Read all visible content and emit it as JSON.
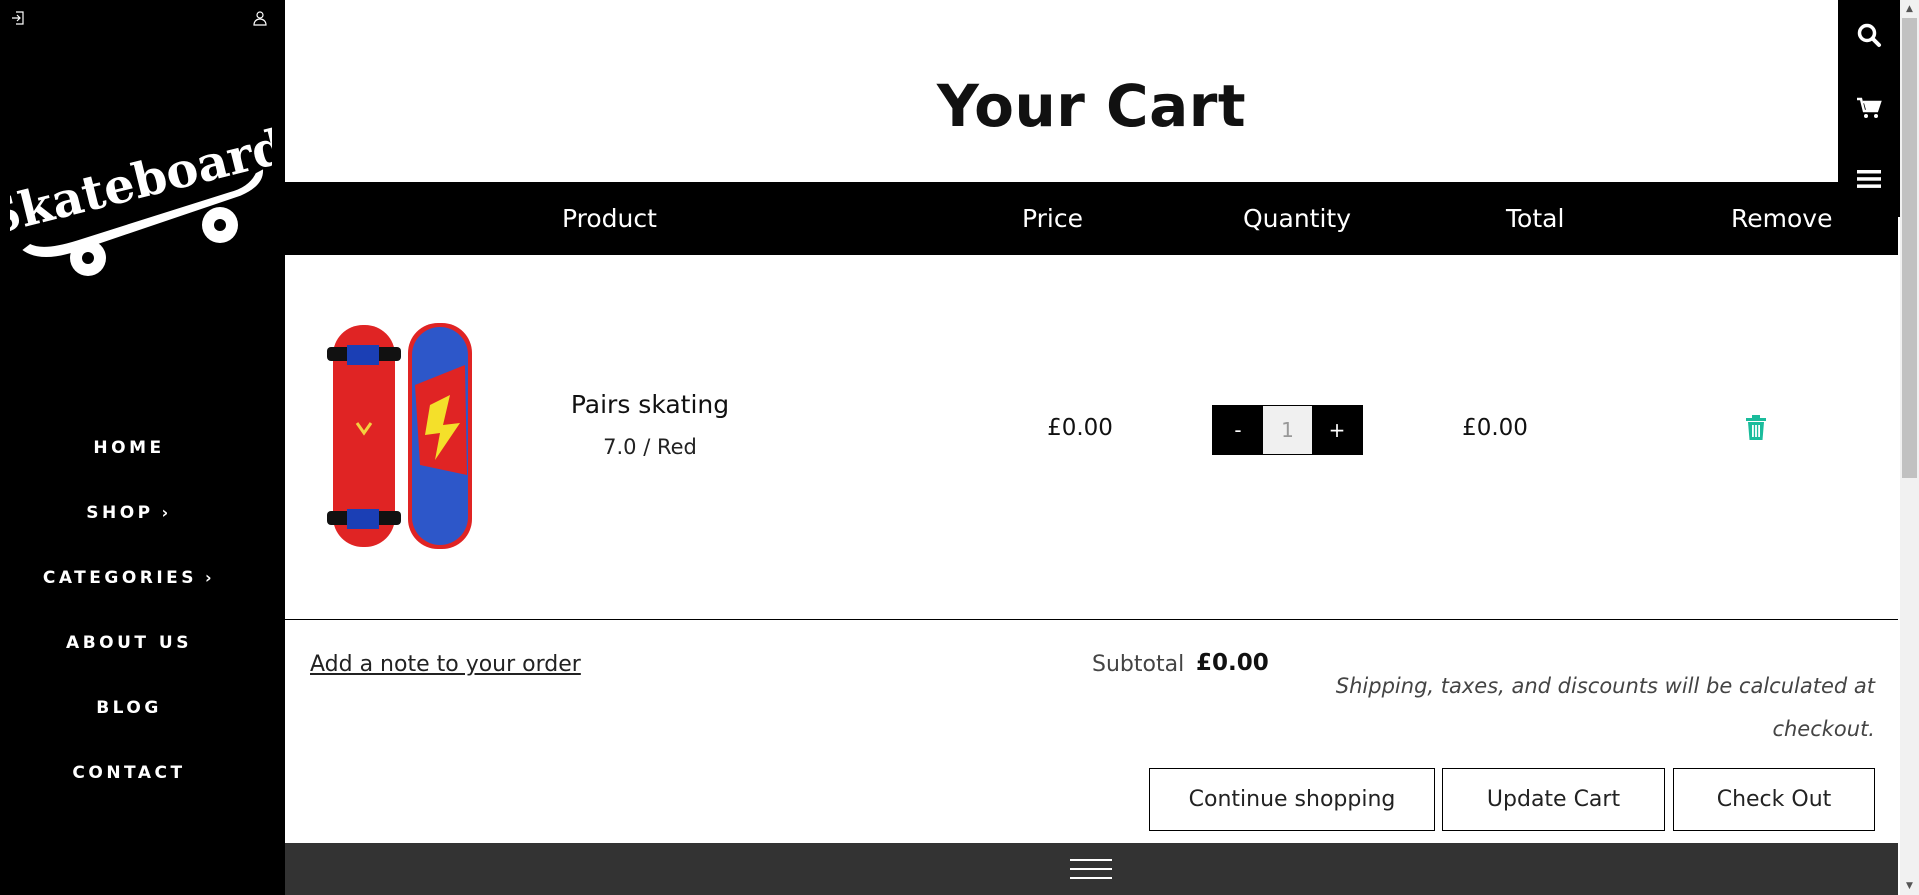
{
  "sidebar": {
    "icons": [
      "sign-in-icon",
      "user-icon"
    ],
    "logo_text": "Skateboard",
    "nav": [
      {
        "label": "HOME",
        "has_submenu": false
      },
      {
        "label": "SHOP",
        "has_submenu": true
      },
      {
        "label": "CATEGORIES",
        "has_submenu": true
      },
      {
        "label": "ABOUT US",
        "has_submenu": false
      },
      {
        "label": "BLOG",
        "has_submenu": false
      },
      {
        "label": "CONTACT",
        "has_submenu": false
      }
    ]
  },
  "page": {
    "title": "Your Cart"
  },
  "iconbar": {
    "icons": [
      "search-icon",
      "cart-icon",
      "menu-icon"
    ]
  },
  "table": {
    "headers": {
      "product": "Product",
      "price": "Price",
      "quantity": "Quantity",
      "total": "Total",
      "remove": "Remove"
    },
    "items": [
      {
        "name": "Pairs skating",
        "variant": "7.0 / Red",
        "price": "£0.00",
        "quantity": "1",
        "qty_minus": "-",
        "qty_plus": "+",
        "total": "£0.00"
      }
    ]
  },
  "footer": {
    "note_link": "Add a note to your order",
    "subtotal_label": "Subtotal",
    "subtotal_value": "£0.00",
    "shipping_note": "Shipping, taxes, and discounts will be calculated at checkout.",
    "buttons": {
      "continue": "Continue shopping",
      "update": "Update Cart",
      "checkout": "Check Out"
    }
  },
  "colors": {
    "sidebar_bg": "#000000",
    "accent_trash": "#1abc9c",
    "bottom_bar": "#333333"
  }
}
